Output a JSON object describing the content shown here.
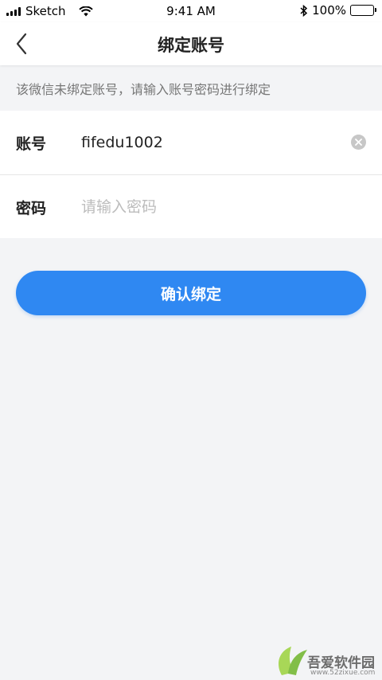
{
  "status": {
    "carrier": "Sketch",
    "time": "9:41 AM",
    "battery": "100%"
  },
  "nav": {
    "title": "绑定账号"
  },
  "hint": "该微信未绑定账号，请输入账号密码进行绑定",
  "form": {
    "account_label": "账号",
    "account_value": "fifedu1002",
    "password_label": "密码",
    "password_placeholder": "请输入密码"
  },
  "confirm_label": "确认绑定",
  "watermark": {
    "title": "吾爱软件园",
    "url": "www.52zixue.com"
  },
  "colors": {
    "primary": "#2f88f2",
    "background": "#f3f4f6"
  }
}
